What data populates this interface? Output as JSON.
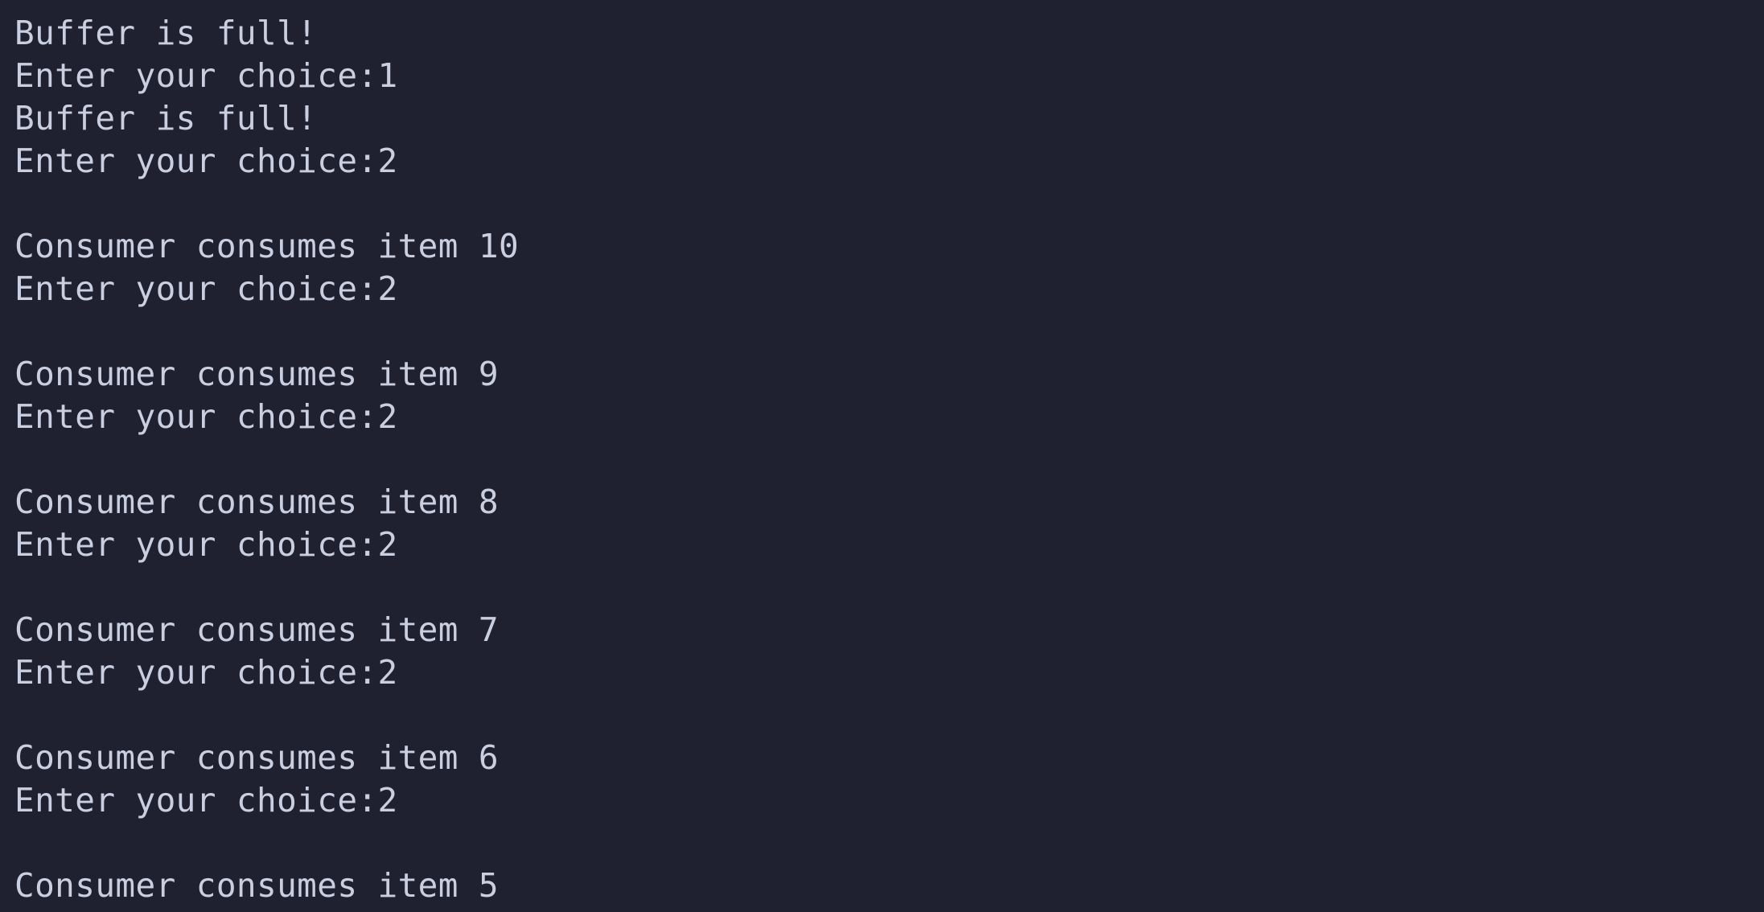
{
  "terminal": {
    "background": "#1f2030",
    "foreground": "#c9cfe0",
    "lines": [
      "Buffer is full!",
      "Enter your choice:1",
      "Buffer is full!",
      "Enter your choice:2",
      "",
      "Consumer consumes item 10",
      "Enter your choice:2",
      "",
      "Consumer consumes item 9",
      "Enter your choice:2",
      "",
      "Consumer consumes item 8",
      "Enter your choice:2",
      "",
      "Consumer consumes item 7",
      "Enter your choice:2",
      "",
      "Consumer consumes item 6",
      "Enter your choice:2",
      "",
      "Consumer consumes item 5"
    ]
  }
}
